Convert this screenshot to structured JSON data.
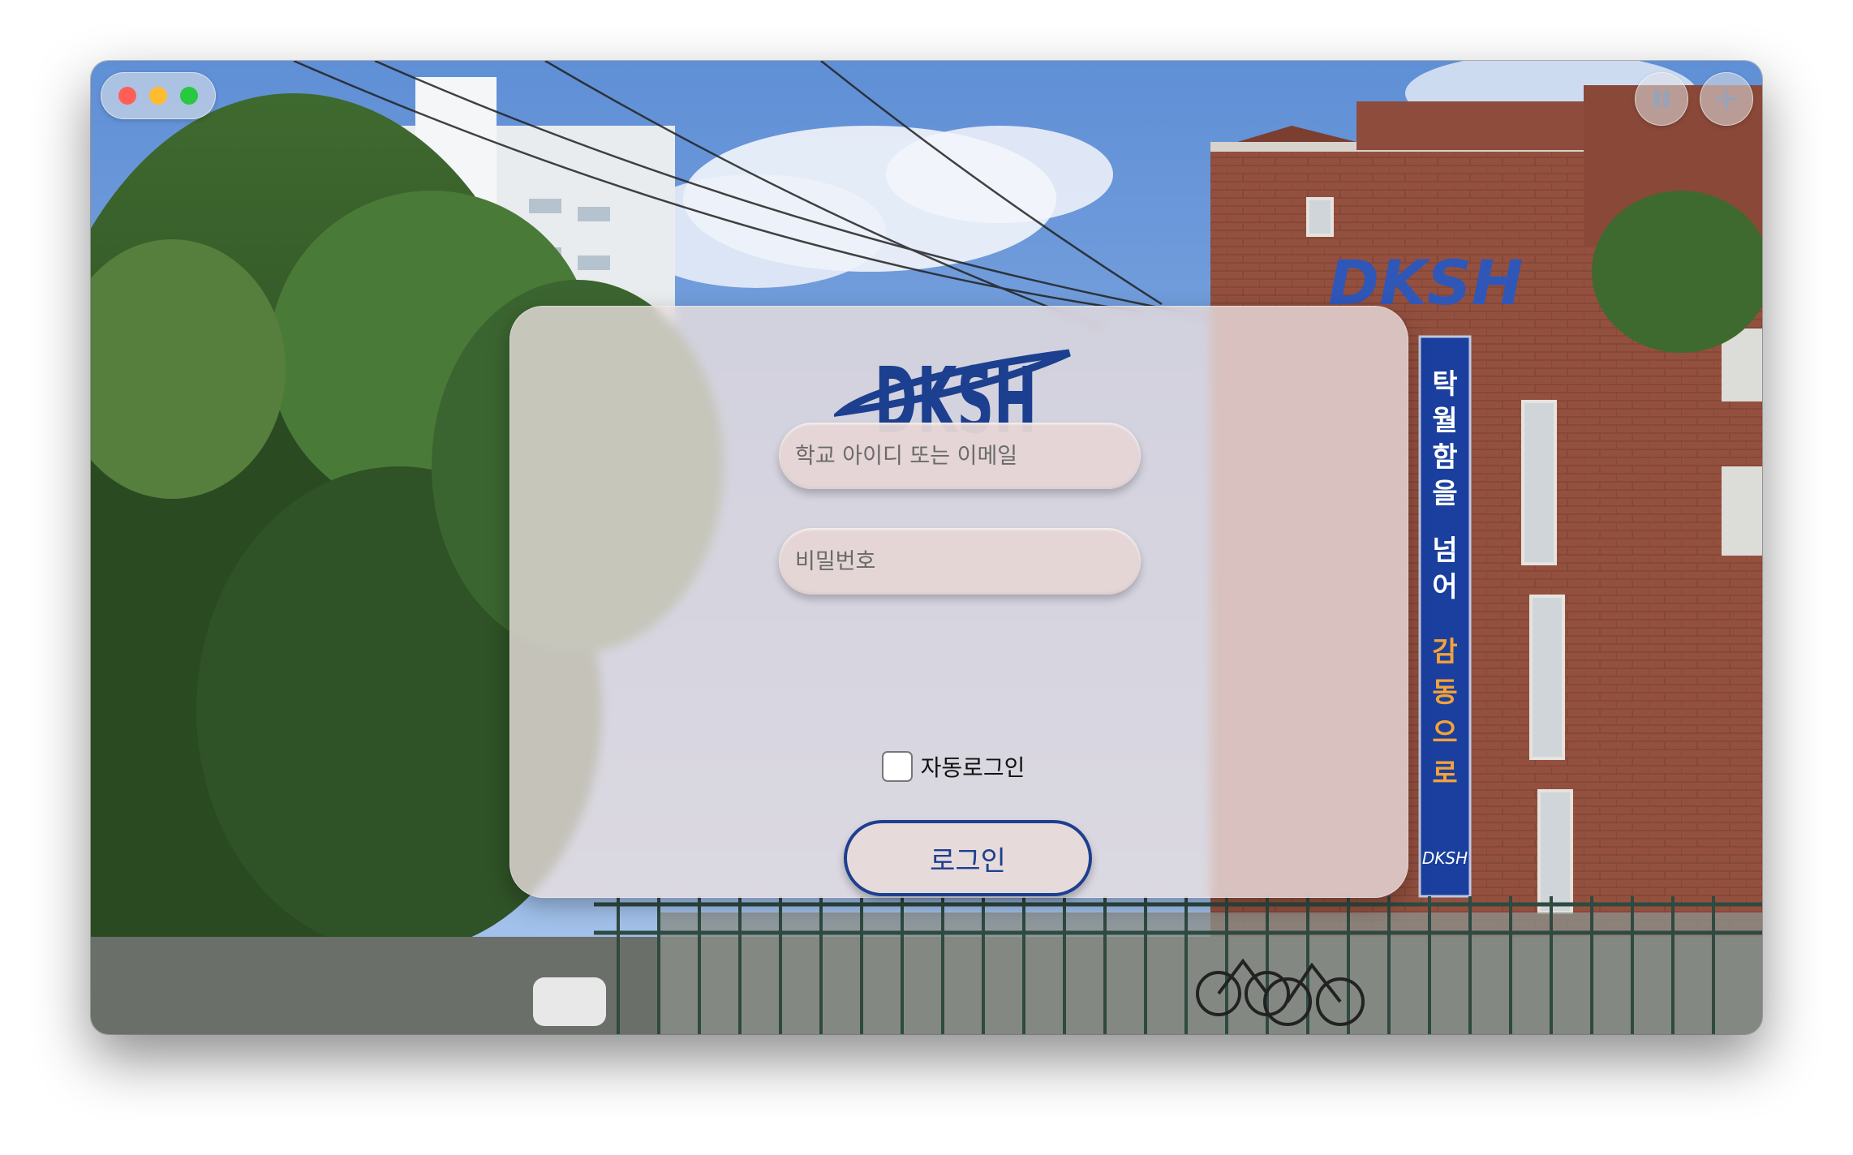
{
  "brand": {
    "logo_text": "DKSH"
  },
  "window": {
    "controls": [
      "close",
      "minimize",
      "maximize"
    ],
    "top_right_buttons": [
      "sidebar-icon",
      "plus-icon"
    ]
  },
  "login": {
    "id_placeholder": "학교 아이디 또는 이메일",
    "password_placeholder": "비밀번호",
    "remember_label": "자동로그인",
    "remember_checked": false,
    "submit_label": "로그인"
  },
  "background": {
    "banner_text": "탁월함을 넘어 감동으로",
    "building_sign": "DKSH"
  },
  "colors": {
    "brand_blue": "#1d3f8f",
    "card_tint": "#eadede",
    "close": "#ff5f57",
    "minimize": "#febc2e",
    "maximize": "#28c840"
  }
}
